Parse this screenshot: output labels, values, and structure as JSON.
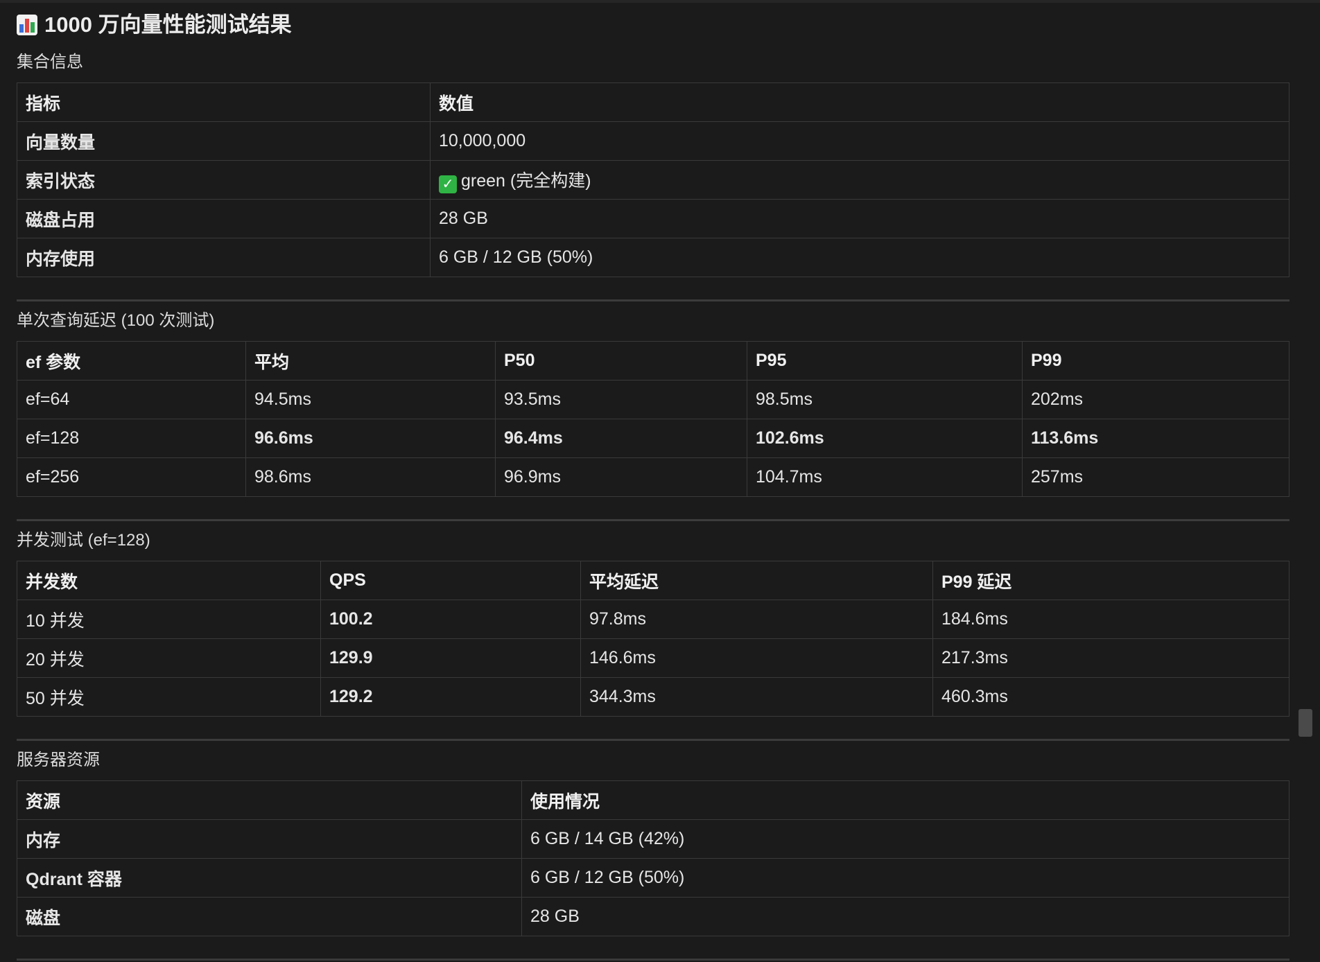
{
  "title": "1000 万向量性能测试结果",
  "title_icon": "bar-chart-icon",
  "collection": {
    "label": "集合信息",
    "headers": [
      "指标",
      "数值"
    ],
    "rows": [
      [
        "向量数量",
        "10,000,000"
      ],
      [
        "索引状态",
        "green (完全构建)"
      ],
      [
        "磁盘占用",
        "28 GB"
      ],
      [
        "内存使用",
        "6 GB / 12 GB (50%)"
      ]
    ],
    "status_icon": "check-mark-icon",
    "status_color": "#2fb344"
  },
  "latency": {
    "label": "单次查询延迟 (100 次测试)",
    "headers": [
      "ef 参数",
      "平均",
      "P50",
      "P95",
      "P99"
    ],
    "rows": [
      [
        "ef=64",
        "94.5ms",
        "93.5ms",
        "98.5ms",
        "202ms"
      ],
      [
        "ef=128",
        "96.6ms",
        "96.4ms",
        "102.6ms",
        "113.6ms"
      ],
      [
        "ef=256",
        "98.6ms",
        "96.9ms",
        "104.7ms",
        "257ms"
      ]
    ]
  },
  "concurrency": {
    "label": "并发测试 (ef=128)",
    "headers": [
      "并发数",
      "QPS",
      "平均延迟",
      "P99 延迟"
    ],
    "rows": [
      [
        "10 并发",
        "100.2",
        "97.8ms",
        "184.6ms"
      ],
      [
        "20 并发",
        "129.9",
        "146.6ms",
        "217.3ms"
      ],
      [
        "50 并发",
        "129.2",
        "344.3ms",
        "460.3ms"
      ]
    ]
  },
  "resources": {
    "label": "服务器资源",
    "headers": [
      "资源",
      "使用情况"
    ],
    "rows": [
      [
        "内存",
        "6 GB / 14 GB (42%)"
      ],
      [
        "Qdrant 容器",
        "6 GB / 12 GB (50%)"
      ],
      [
        "磁盘",
        "28 GB"
      ]
    ]
  },
  "colors": {
    "background": "#1b1b1b",
    "border": "#3a3a3a",
    "text": "#e6e6e6"
  }
}
